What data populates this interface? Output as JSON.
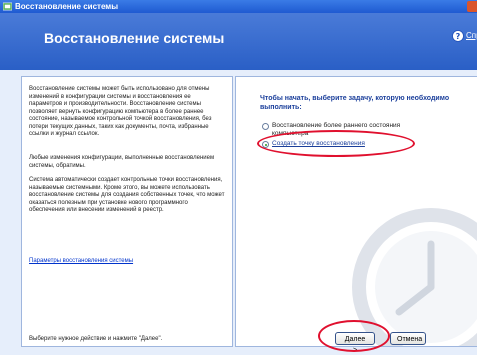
{
  "window": {
    "title": "Восстановление системы"
  },
  "header": {
    "title": "Восстановление системы",
    "help_label": "Справка"
  },
  "left_panel": {
    "paragraphs": [
      "Восстановление системы может быть использовано для отмены изменений в конфигурации системы и восстановления ее параметров и производительности. Восстановление системы позволяет вернуть конфигурацию компьютера в более раннее состояние, называемое контрольной точкой восстановления, без потери текущих данных, таких как документы, почта, избранные ссылки и журнал ссылок.",
      "Любые изменения конфигурации, выполненные восстановлением системы, обратимы.",
      "Система автоматически создает контрольные точки восстановления, называемые системными. Кроме этого, вы можете использовать восстановление системы для создания собственных точек, что может оказаться полезным при установке нового программного обеспечения или внесении изменений в реестр."
    ],
    "settings_link": "Параметры восстановления системы",
    "hint": "Выберите нужное действие и нажмите \"Далее\"."
  },
  "right_panel": {
    "prompt": "Чтобы начать, выберите задачу, которую необходимо выполнить:",
    "options": [
      {
        "label": "Восстановление более раннего состояния компьютера",
        "selected": false
      },
      {
        "label": "Создать точку восстановления",
        "selected": true
      }
    ]
  },
  "buttons": {
    "next": "Далее >",
    "cancel": "Отмена"
  },
  "colors": {
    "accent": "#2a5fc6",
    "annotation": "#e0102e"
  }
}
